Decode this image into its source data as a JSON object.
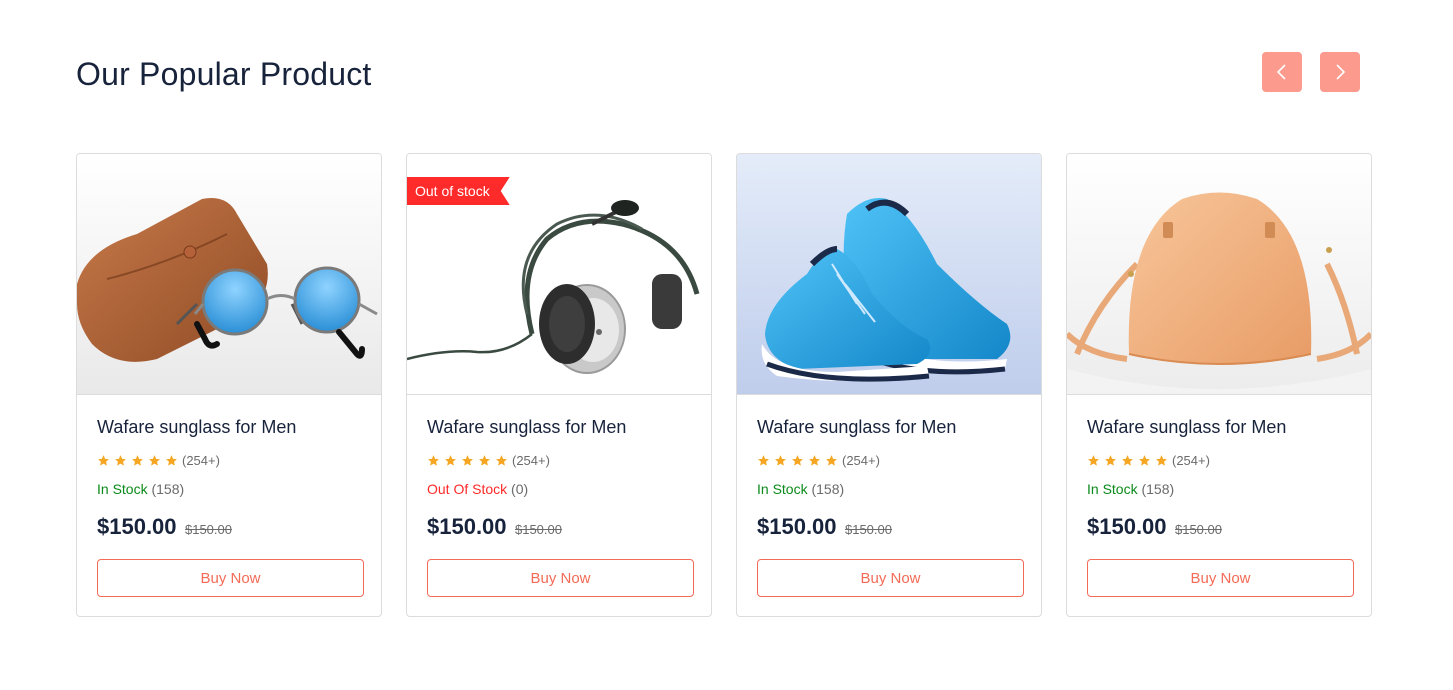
{
  "section": {
    "title": "Our Popular Product"
  },
  "colors": {
    "accent": "#f36b57",
    "nav_button": "#fb9a8d",
    "in_stock": "#0a8a1a",
    "out_of_stock": "#ff2a2a",
    "star": "#f5a623",
    "heading": "#17223b"
  },
  "icons": {
    "prev": "chevron-left-icon",
    "next": "chevron-right-icon",
    "star": "star-icon"
  },
  "products": [
    {
      "image": "sunglasses-with-case",
      "name": "Wafare sunglass for Men",
      "rating_stars": 5,
      "rating_count": "(254+)",
      "stock_status": "In Stock",
      "stock_count": "(158)",
      "price": "$150.00",
      "old_price": "$150.00",
      "button": "Buy Now"
    },
    {
      "image": "headset",
      "badge": "Out of stock",
      "name": "Wafare sunglass for Men",
      "rating_stars": 5,
      "rating_count": "(254+)",
      "stock_status": "Out Of Stock",
      "stock_count": "(0)",
      "price": "$150.00",
      "old_price": "$150.00",
      "button": "Buy Now"
    },
    {
      "image": "blue-sneakers",
      "name": "Wafare sunglass for Men",
      "rating_stars": 5,
      "rating_count": "(254+)",
      "stock_status": "In Stock",
      "stock_count": "(158)",
      "price": "$150.00",
      "old_price": "$150.00",
      "button": "Buy Now"
    },
    {
      "image": "peach-handbag",
      "name": "Wafare sunglass for Men",
      "rating_stars": 5,
      "rating_count": "(254+)",
      "stock_status": "In Stock",
      "stock_count": "(158)",
      "price": "$150.00",
      "old_price": "$150.00",
      "button": "Buy Now"
    }
  ]
}
